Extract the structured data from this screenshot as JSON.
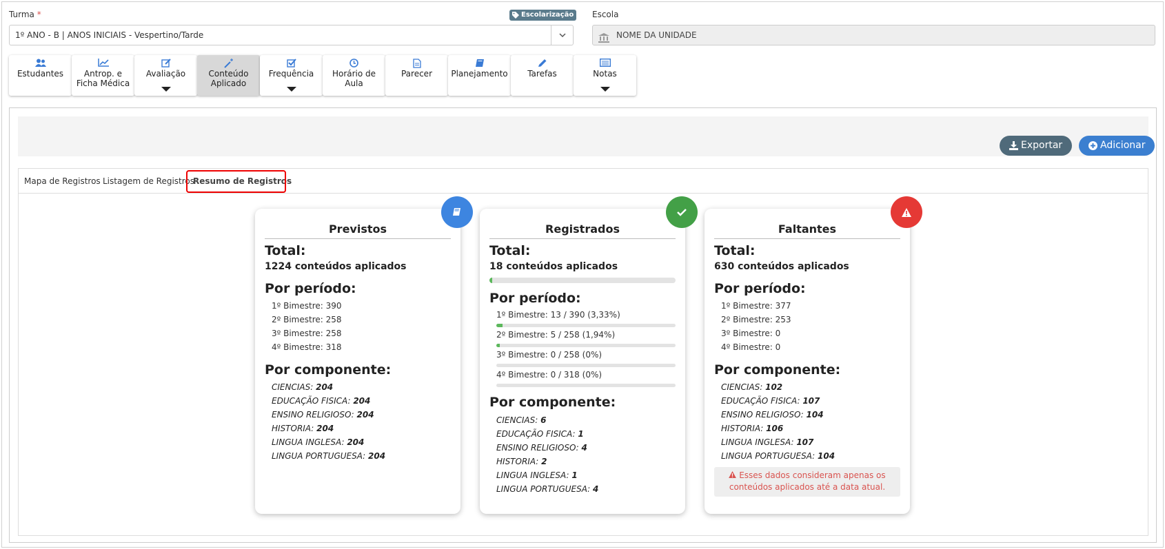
{
  "turma": {
    "label": "Turma",
    "required_mark": "*",
    "value": "1º ANO - B | ANOS INICIAIS - Vespertino/Tarde",
    "tag": "Escolarização"
  },
  "escola": {
    "label": "Escola",
    "value": "NOME DA UNIDADE"
  },
  "toolbar": [
    {
      "label_1": "Estudantes",
      "label_2": "",
      "icon": "users-icon",
      "dropdown": false,
      "active": false
    },
    {
      "label_1": "Antrop. e",
      "label_2": "Ficha Médica",
      "icon": "chart-line-icon",
      "dropdown": false,
      "active": false
    },
    {
      "label_1": "Avaliação",
      "label_2": "",
      "icon": "edit-icon",
      "dropdown": true,
      "active": false
    },
    {
      "label_1": "Conteúdo",
      "label_2": "Aplicado",
      "icon": "magic-wand-icon",
      "dropdown": false,
      "active": true
    },
    {
      "label_1": "Frequência",
      "label_2": "",
      "icon": "check-square-icon",
      "dropdown": true,
      "active": false
    },
    {
      "label_1": "Horário de",
      "label_2": "Aula",
      "icon": "clock-icon",
      "dropdown": false,
      "active": false
    },
    {
      "label_1": "Parecer",
      "label_2": "",
      "icon": "file-icon",
      "dropdown": false,
      "active": false
    },
    {
      "label_1": "Planejamento",
      "label_2": "",
      "icon": "book-icon",
      "dropdown": false,
      "active": false
    },
    {
      "label_1": "Tarefas",
      "label_2": "",
      "icon": "pencil-icon",
      "dropdown": false,
      "active": false
    },
    {
      "label_1": "Notas",
      "label_2": "",
      "icon": "list-icon",
      "dropdown": true,
      "active": false
    }
  ],
  "actions": {
    "export_label": "Exportar",
    "add_label": "Adicionar"
  },
  "tabs": [
    {
      "label": "Mapa de Registros"
    },
    {
      "label": "Listagem de Registros"
    },
    {
      "label": "Resumo de Registros"
    }
  ],
  "colors": {
    "previstos_badge": "#3d85e0",
    "registrados_badge": "#43a047",
    "faltantes_badge": "#e53935",
    "progress": "#5cb85c",
    "warning_text": "#d9534f"
  },
  "cards": {
    "total_label": "Total:",
    "periodo_label": "Por período:",
    "componente_label": "Por componente:",
    "previstos": {
      "title": "Previstos",
      "total": "1224 conteúdos aplicados",
      "periods": [
        "1º Bimestre: 390",
        "2º Bimestre: 258",
        "3º Bimestre: 258",
        "4º Bimestre: 318"
      ],
      "components": [
        {
          "name": "CIENCIAS:",
          "value": "204"
        },
        {
          "name": "EDUCAÇÃO FISICA:",
          "value": "204"
        },
        {
          "name": "ENSINO RELIGIOSO:",
          "value": "204"
        },
        {
          "name": "HISTORIA:",
          "value": "204"
        },
        {
          "name": "LINGUA INGLESA:",
          "value": "204"
        },
        {
          "name": "LINGUA PORTUGUESA:",
          "value": "204"
        }
      ]
    },
    "registrados": {
      "title": "Registrados",
      "total": "18 conteúdos aplicados",
      "total_progress": 0.0147,
      "periods": [
        {
          "text": "1º Bimestre: 13 / 390 (3,33%)",
          "progress": 0.0333
        },
        {
          "text": "2º Bimestre: 5 / 258 (1,94%)",
          "progress": 0.0194
        },
        {
          "text": "3º Bimestre: 0 / 258 (0%)",
          "progress": 0
        },
        {
          "text": "4º Bimestre: 0 / 318 (0%)",
          "progress": 0
        }
      ],
      "components": [
        {
          "name": "CIENCIAS:",
          "value": "6"
        },
        {
          "name": "EDUCAÇÃO FISICA:",
          "value": "1"
        },
        {
          "name": "ENSINO RELIGIOSO:",
          "value": "4"
        },
        {
          "name": "HISTORIA:",
          "value": "2"
        },
        {
          "name": "LINGUA INGLESA:",
          "value": "1"
        },
        {
          "name": "LINGUA PORTUGUESA:",
          "value": "4"
        }
      ]
    },
    "faltantes": {
      "title": "Faltantes",
      "total": "630 conteúdos aplicados",
      "periods": [
        "1º Bimestre: 377",
        "2º Bimestre: 253",
        "3º Bimestre: 0",
        "4º Bimestre: 0"
      ],
      "components": [
        {
          "name": "CIENCIAS:",
          "value": "102"
        },
        {
          "name": "EDUCAÇÃO FISICA:",
          "value": "107"
        },
        {
          "name": "ENSINO RELIGIOSO:",
          "value": "104"
        },
        {
          "name": "HISTORIA:",
          "value": "106"
        },
        {
          "name": "LINGUA INGLESA:",
          "value": "107"
        },
        {
          "name": "LINGUA PORTUGUESA:",
          "value": "104"
        }
      ],
      "warning_line_1": "Esses dados consideram apenas os",
      "warning_line_2": "conteúdos aplicados até a data atual."
    }
  }
}
